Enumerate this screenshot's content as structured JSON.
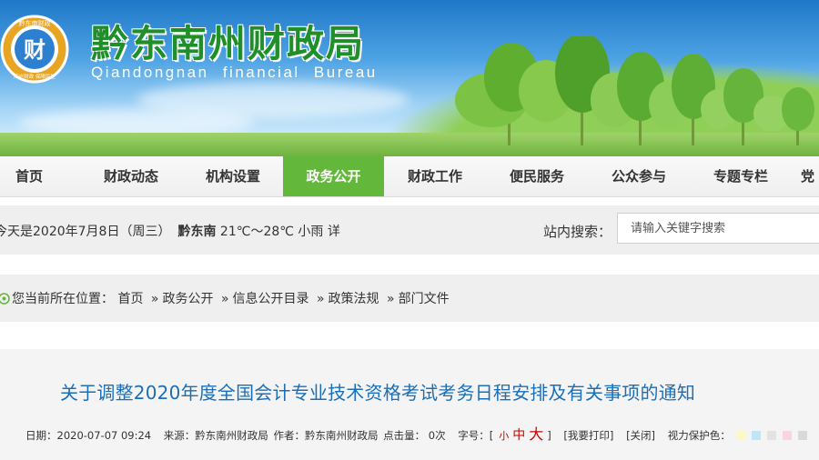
{
  "header": {
    "title_cn": "黔东南州财政局",
    "title_en": "Qiandongnan financial Bureau",
    "logo": {
      "icon": "government-seal-logo",
      "ring_text_top": "黔东南财政",
      "ring_text_bottom": "阳光财政 保障民生",
      "center_char": "财"
    }
  },
  "nav": {
    "items": [
      {
        "label": "首页"
      },
      {
        "label": "财政动态"
      },
      {
        "label": "机构设置"
      },
      {
        "label": "政务公开",
        "active": true
      },
      {
        "label": "财政工作"
      },
      {
        "label": "便民服务"
      },
      {
        "label": "公众参与"
      },
      {
        "label": "专题专栏"
      },
      {
        "label": "党"
      }
    ],
    "active_color": "#63b83b"
  },
  "infobar": {
    "date_text": "今天是2020年7月8日（周三）",
    "region": "黔东南",
    "weather": "21℃～28℃ 小雨 详",
    "search_label": "站内搜索：",
    "search_placeholder": "请输入关键字搜索"
  },
  "breadcrumb": {
    "prefix": "您当前所在位置：",
    "items": [
      "首页",
      "政务公开",
      "信息公开目录",
      "政策法规",
      "部门文件"
    ],
    "separator": "»"
  },
  "article": {
    "title": "关于调整2020年度全国会计专业技术资格考试考务日程安排及有关事项的通知",
    "title_color": "#1a6fb8",
    "meta": {
      "date": "日期：2020-07-07 09:24",
      "source": "来源：黔东南州财政局",
      "author": "作者：黔东南州财政局",
      "hits": "点击量： 0次",
      "font_size_label": "字号：[",
      "font_small": "小",
      "font_medium": "中",
      "font_large": "大",
      "font_size_close": "]",
      "print": "[我要打印]",
      "close": "[关闭]",
      "eye_care_label": "视力保护色：",
      "eye_care_colors": [
        "#faf9c6",
        "#bfe6f5",
        "#e3e3e3",
        "#f7d6df",
        "#d9d9d9"
      ]
    }
  }
}
